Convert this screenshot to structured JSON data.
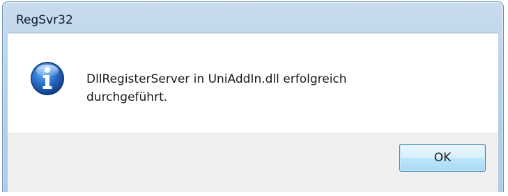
{
  "window": {
    "title": "RegSvr32"
  },
  "dialog": {
    "icon": "info-icon",
    "message_line1": "DllRegisterServer in UniAddIn.dll erfolgreich",
    "message_line2": "durchgeführt.",
    "ok_label": "OK"
  },
  "colors": {
    "titlebar": "#b9d0e8",
    "footer": "#f0f0f0",
    "icon_blue": "#1c5fb8",
    "button_border": "#3c7fb1"
  }
}
